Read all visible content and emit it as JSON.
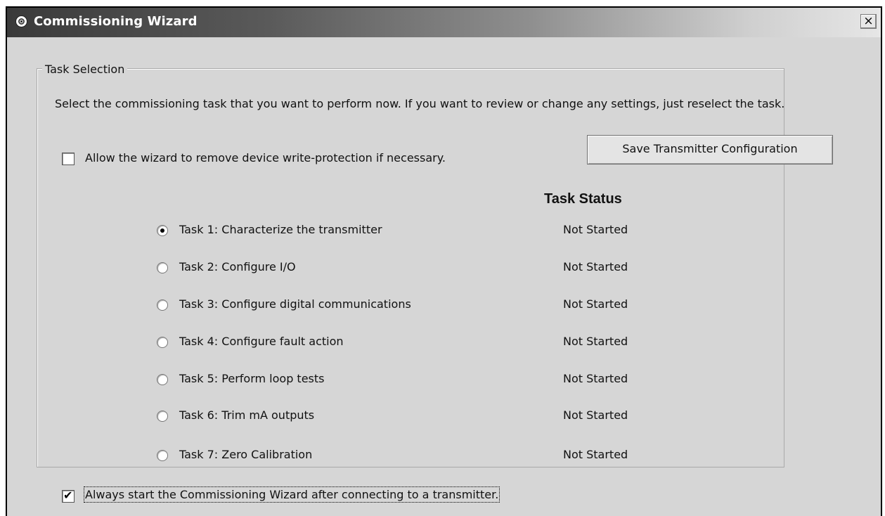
{
  "window": {
    "title": "Commissioning Wizard",
    "close_glyph": "×",
    "icon": "app-icon"
  },
  "group": {
    "legend": "Task Selection",
    "instructions": "Select the commissioning task that you want to perform now. If you want to review or change any settings, just reselect the task."
  },
  "write_protect": {
    "label": "Allow the wizard to remove device write-protection if necessary.",
    "checked": false
  },
  "save_button": {
    "label": "Save Transmitter Configuration"
  },
  "status_header": "Task Status",
  "tasks": [
    {
      "label": "Task 1: Characterize the transmitter",
      "status": "Not Started",
      "selected": true
    },
    {
      "label": "Task 2: Configure I/O",
      "status": "Not Started",
      "selected": false
    },
    {
      "label": "Task 3: Configure digital communications",
      "status": "Not Started",
      "selected": false
    },
    {
      "label": "Task 4: Configure fault action",
      "status": "Not Started",
      "selected": false
    },
    {
      "label": "Task 5: Perform loop tests",
      "status": "Not Started",
      "selected": false
    },
    {
      "label": "Task 6: Trim mA outputs",
      "status": "Not Started",
      "selected": false
    },
    {
      "label": "Task 7: Zero Calibration",
      "status": "Not Started",
      "selected": false
    }
  ],
  "always_start": {
    "label": "Always start the Commissioning Wizard after connecting to a transmitter.",
    "checked": true
  },
  "colors": {
    "dialog_bg": "#d6d6d6",
    "title_text": "#ffffff"
  }
}
